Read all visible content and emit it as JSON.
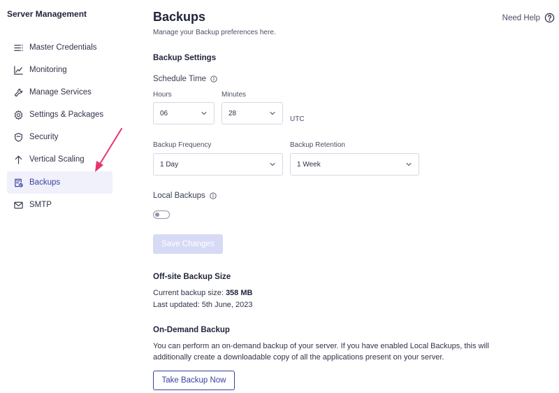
{
  "sidebar": {
    "title": "Server Management",
    "items": [
      {
        "label": "Master Credentials",
        "icon": "list-lines-icon"
      },
      {
        "label": "Monitoring",
        "icon": "chart-line-icon"
      },
      {
        "label": "Manage Services",
        "icon": "wrench-icon"
      },
      {
        "label": "Settings & Packages",
        "icon": "gear-icon"
      },
      {
        "label": "Security",
        "icon": "shield-icon"
      },
      {
        "label": "Vertical Scaling",
        "icon": "arrow-up-icon"
      },
      {
        "label": "Backups",
        "icon": "backup-icon",
        "active": true
      },
      {
        "label": "SMTP",
        "icon": "mail-icon"
      }
    ]
  },
  "header": {
    "title": "Backups",
    "subtitle": "Manage your Backup preferences here.",
    "help_label": "Need Help"
  },
  "backup_settings": {
    "heading": "Backup Settings",
    "schedule_label": "Schedule Time",
    "hours_label": "Hours",
    "hours_value": "06",
    "minutes_label": "Minutes",
    "minutes_value": "28",
    "timezone": "UTC",
    "frequency_label": "Backup Frequency",
    "frequency_value": "1 Day",
    "retention_label": "Backup Retention",
    "retention_value": "1 Week",
    "local_backups_label": "Local Backups",
    "local_backups_enabled": false,
    "save_label": "Save Changes"
  },
  "offsite": {
    "heading": "Off-site Backup Size",
    "size_prefix": "Current backup size: ",
    "size_value": "358 MB",
    "updated_text": "Last updated: 5th June, 2023"
  },
  "on_demand": {
    "heading": "On-Demand Backup",
    "desc_line1": "You can perform an on-demand backup of your server. If you have enabled Local Backups, this will",
    "desc_line2": "additionally create a downloadable copy of all the applications present on your server.",
    "button_label": "Take Backup Now"
  },
  "colors": {
    "accent": "#3a3f9e",
    "annotation_arrow": "#e8336f",
    "active_bg": "#f0f1fb"
  }
}
